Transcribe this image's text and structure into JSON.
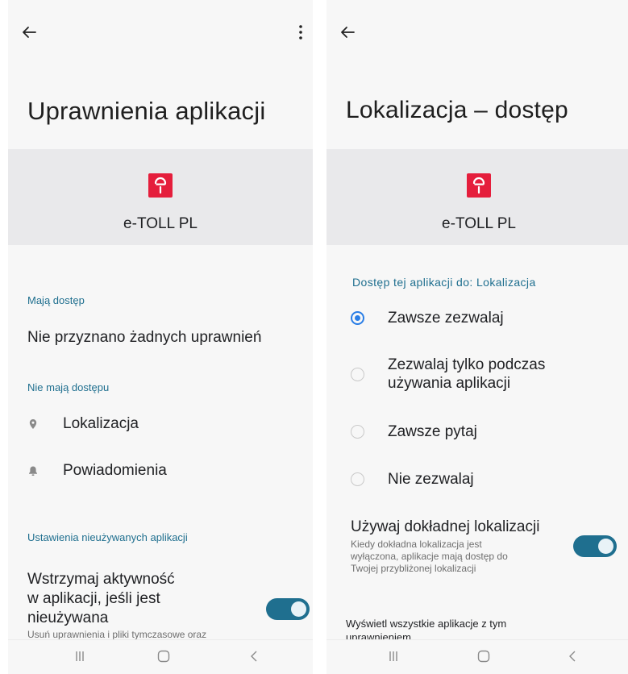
{
  "left": {
    "title": "Uprawnienia aplikacji",
    "app_name": "e-TOLL PL",
    "allowed_label": "Mają dostęp",
    "allowed_none": "Nie przyznano żadnych uprawnień",
    "denied_label": "Nie mają dostępu",
    "denied_items": [
      "Lokalizacja",
      "Powiadomienia"
    ],
    "unused_label": "Ustawienia nieużywanych aplikacji",
    "pause_line1": "Wstrzymaj aktywność",
    "pause_line2": "w aplikacji, jeśli jest",
    "pause_line3": "nieużywana",
    "pause_sub": "Usuń uprawnienia i pliki tymczasowe oraz",
    "pause_toggle_on": true
  },
  "right": {
    "title": "Lokalizacja – dostęp",
    "app_name": "e-TOLL PL",
    "access_label": "Dostęp tej aplikacji do: Lokalizacja",
    "options": [
      {
        "line1": "Zawsze zezwalaj",
        "line2": "",
        "checked": true
      },
      {
        "line1": "Zezwalaj tylko podczas",
        "line2": "używania aplikacji",
        "checked": false
      },
      {
        "line1": "Zawsze pytaj",
        "line2": "",
        "checked": false
      },
      {
        "line1": "Nie zezwalaj",
        "line2": "",
        "checked": false
      }
    ],
    "precise_title": "Używaj dokładnej lokalizacji",
    "precise_sub1": "Kiedy dokładna lokalizacja jest",
    "precise_sub2": "wyłączona, aplikacje mają dostęp do",
    "precise_sub3": "Twojej przybliżonej lokalizacji",
    "precise_toggle_on": true,
    "all_apps_line1": "Wyświetl wszystkie aplikacje z tym",
    "all_apps_line2": "uprawnieniem"
  },
  "colors": {
    "accent": "#1f6f8f",
    "radio_checked": "#2a7ee6",
    "logo": "#e51e3c"
  },
  "icons": {
    "back": "arrow-left-icon",
    "more": "more-vertical-icon",
    "location": "location-pin-icon",
    "notification": "bell-icon",
    "nav_recents": "recents-icon",
    "nav_home": "home-icon",
    "nav_back": "chevron-left-icon"
  }
}
